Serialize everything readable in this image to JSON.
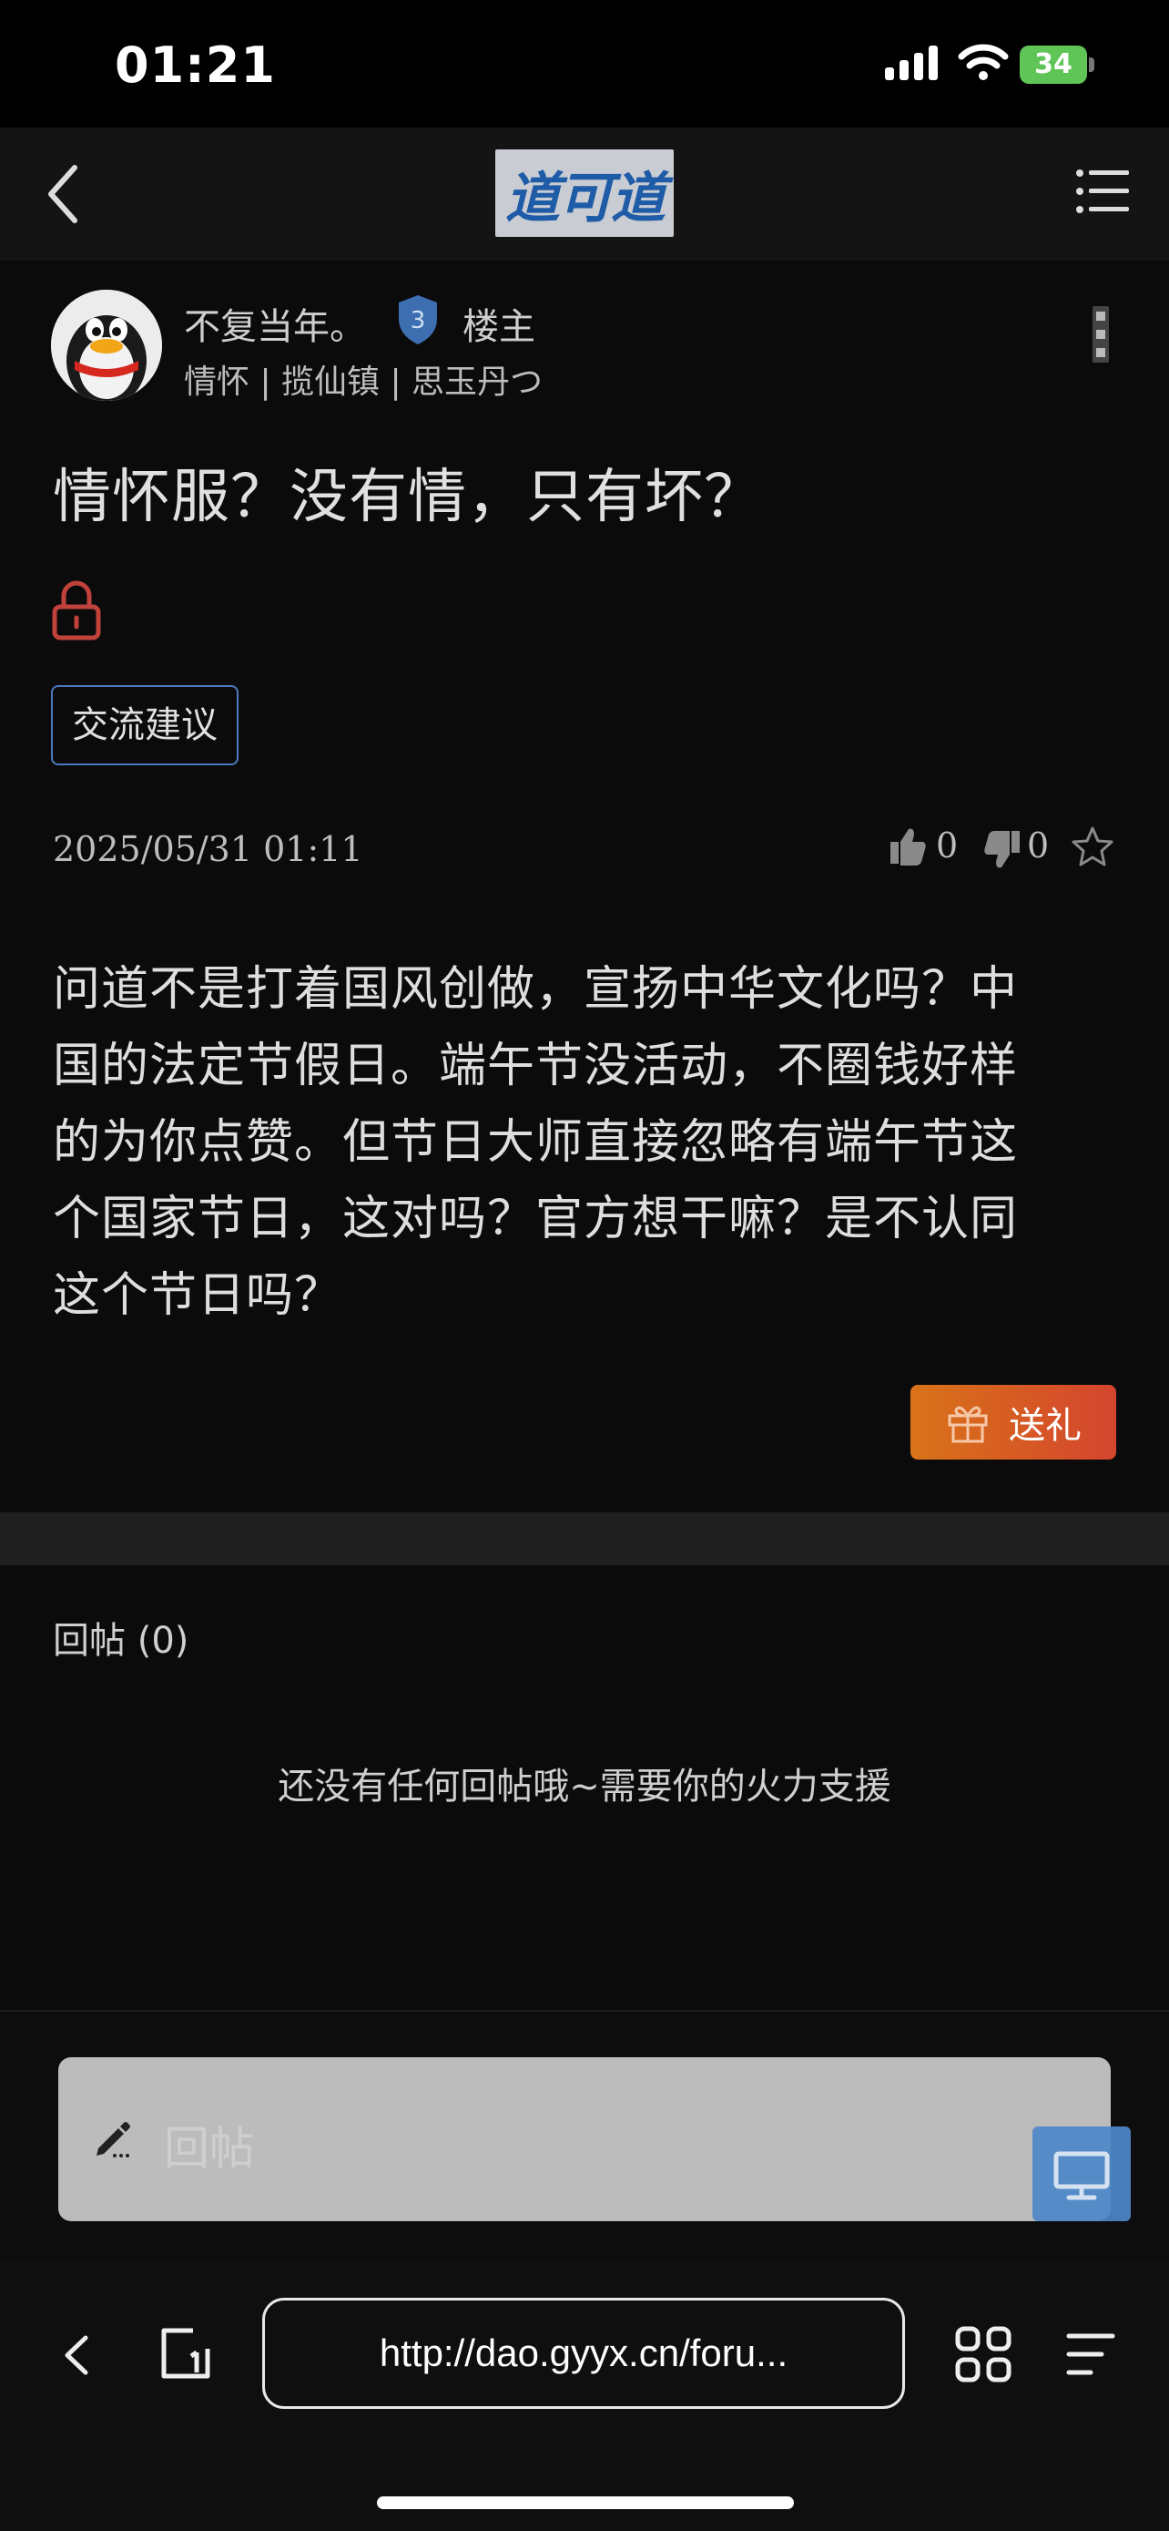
{
  "status_bar": {
    "time": "01:21",
    "battery": "34"
  },
  "header": {
    "logo_text": "道可道"
  },
  "post": {
    "author": "不复当年。",
    "level": "3",
    "owner_label": "楼主",
    "author_meta": "情怀 | 揽仙镇 | 思玉丹つ",
    "title": "情怀服？没有情，只有坏？",
    "tag": "交流建议",
    "date": "2025/05/31 01:11",
    "likes": "0",
    "dislikes": "0",
    "body_lines": [
      "问道不是打着国风创做，宣扬中华文化吗？中",
      "国的法定节假日。端午节没活动，不圈钱好样",
      "的为你点赞。但节日大师直接忽略有端午节这",
      "个国家节日，这对吗？官方想干嘛？是不认同",
      "这个节日吗？"
    ],
    "gift_label": "送礼"
  },
  "replies": {
    "header": "回帖 (0)",
    "empty_text": "还没有任何回帖哦~需要你的火力支援"
  },
  "reply_bar": {
    "placeholder": "回帖"
  },
  "browser": {
    "url": "http://dao.gyyx.cn/foru..."
  },
  "colors": {
    "accent_blue": "#4c7bbd",
    "gift_gradient_start": "#d97318",
    "gift_gradient_end": "#d4452e",
    "battery_green": "#5fc556"
  }
}
